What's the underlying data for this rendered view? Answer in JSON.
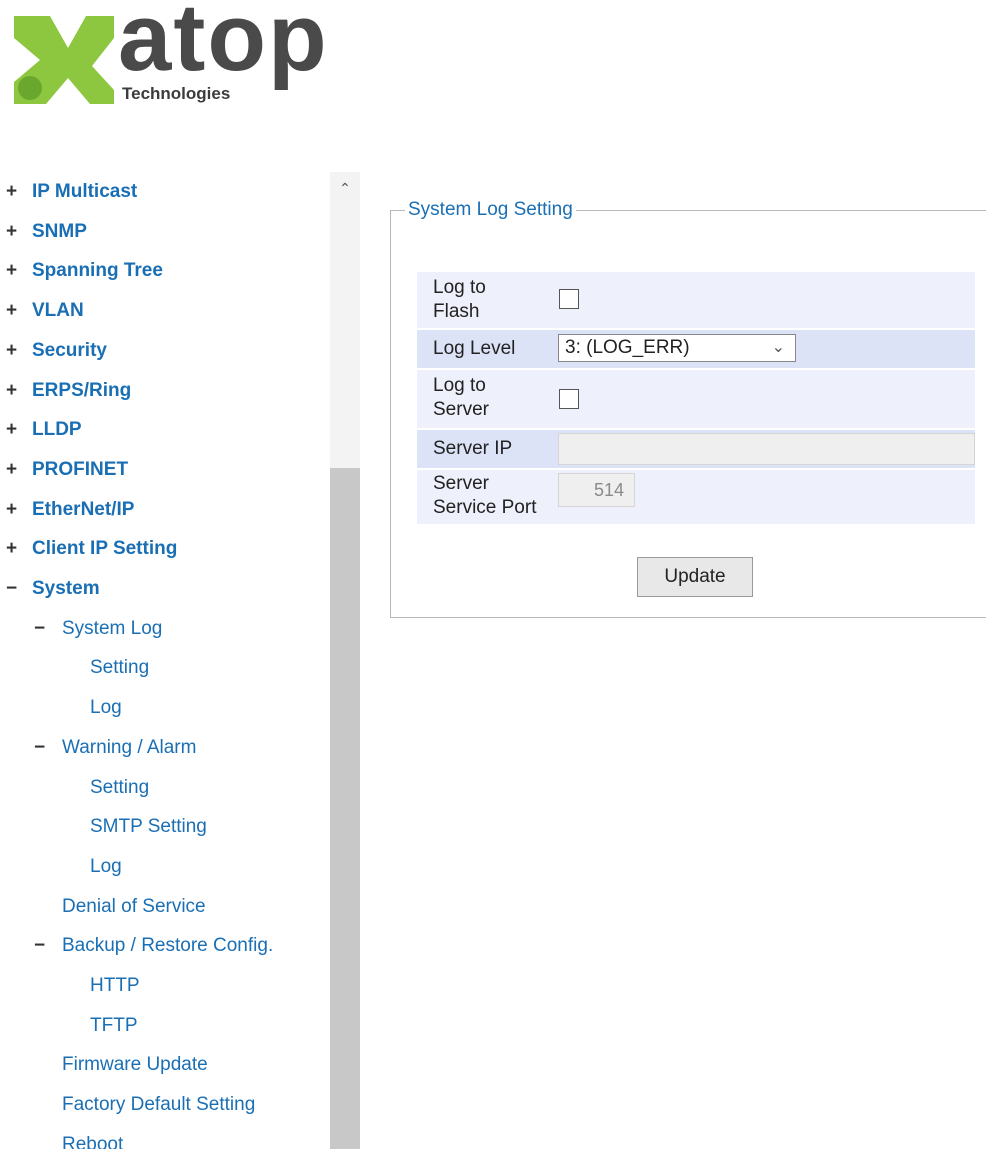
{
  "logo": {
    "word": "atop",
    "sub": "Technologies",
    "colors": {
      "green": "#8dc63f",
      "dark": "#4a4a4a"
    }
  },
  "sidebar": {
    "items": [
      {
        "sign": "+",
        "label": "IP Multicast",
        "level": "top"
      },
      {
        "sign": "+",
        "label": "SNMP",
        "level": "top"
      },
      {
        "sign": "+",
        "label": "Spanning Tree",
        "level": "top"
      },
      {
        "sign": "+",
        "label": "VLAN",
        "level": "top"
      },
      {
        "sign": "+",
        "label": "Security",
        "level": "top"
      },
      {
        "sign": "+",
        "label": "ERPS/Ring",
        "level": "top"
      },
      {
        "sign": "+",
        "label": "LLDP",
        "level": "top"
      },
      {
        "sign": "+",
        "label": "PROFINET",
        "level": "top"
      },
      {
        "sign": "+",
        "label": "EtherNet/IP",
        "level": "top"
      },
      {
        "sign": "+",
        "label": "Client IP Setting",
        "level": "top"
      },
      {
        "sign": "−",
        "label": "System",
        "level": "top"
      },
      {
        "sign": "−",
        "label": "System Log",
        "level": "sub"
      },
      {
        "sign": "",
        "label": "Setting",
        "level": "leaf"
      },
      {
        "sign": "",
        "label": "Log",
        "level": "leaf"
      },
      {
        "sign": "−",
        "label": "Warning / Alarm",
        "level": "sub"
      },
      {
        "sign": "",
        "label": "Setting",
        "level": "leaf"
      },
      {
        "sign": "",
        "label": "SMTP Setting",
        "level": "leaf"
      },
      {
        "sign": "",
        "label": "Log",
        "level": "leaf"
      },
      {
        "sign": "",
        "label": "Denial of Service",
        "level": "leaf2"
      },
      {
        "sign": "−",
        "label": "Backup / Restore Config.",
        "level": "sub"
      },
      {
        "sign": "",
        "label": "HTTP",
        "level": "leaf"
      },
      {
        "sign": "",
        "label": "TFTP",
        "level": "leaf"
      },
      {
        "sign": "",
        "label": "Firmware Update",
        "level": "leaf2"
      },
      {
        "sign": "",
        "label": "Factory Default Setting",
        "level": "leaf2"
      },
      {
        "sign": "",
        "label": "Reboot",
        "level": "leaf2"
      }
    ],
    "scroll_up_icon": "chevron-up-icon"
  },
  "form": {
    "legend": "System Log Setting",
    "log_to_flash_label_1": "Log to",
    "log_to_flash_label_2": "Flash",
    "log_to_flash_checked": false,
    "log_level_label": "Log Level",
    "log_level_value": "3: (LOG_ERR)",
    "log_to_server_label_1": "Log to",
    "log_to_server_label_2": "Server",
    "log_to_server_checked": false,
    "server_ip_label": "Server IP",
    "server_ip_value": "",
    "server_port_label_1": "Server",
    "server_port_label_2": "Service Port",
    "server_port_value": "514",
    "update_button": "Update"
  },
  "colors": {
    "row_light": "#eef0fb",
    "row_dark": "#dde3f7",
    "link": "#1a6fb4"
  }
}
